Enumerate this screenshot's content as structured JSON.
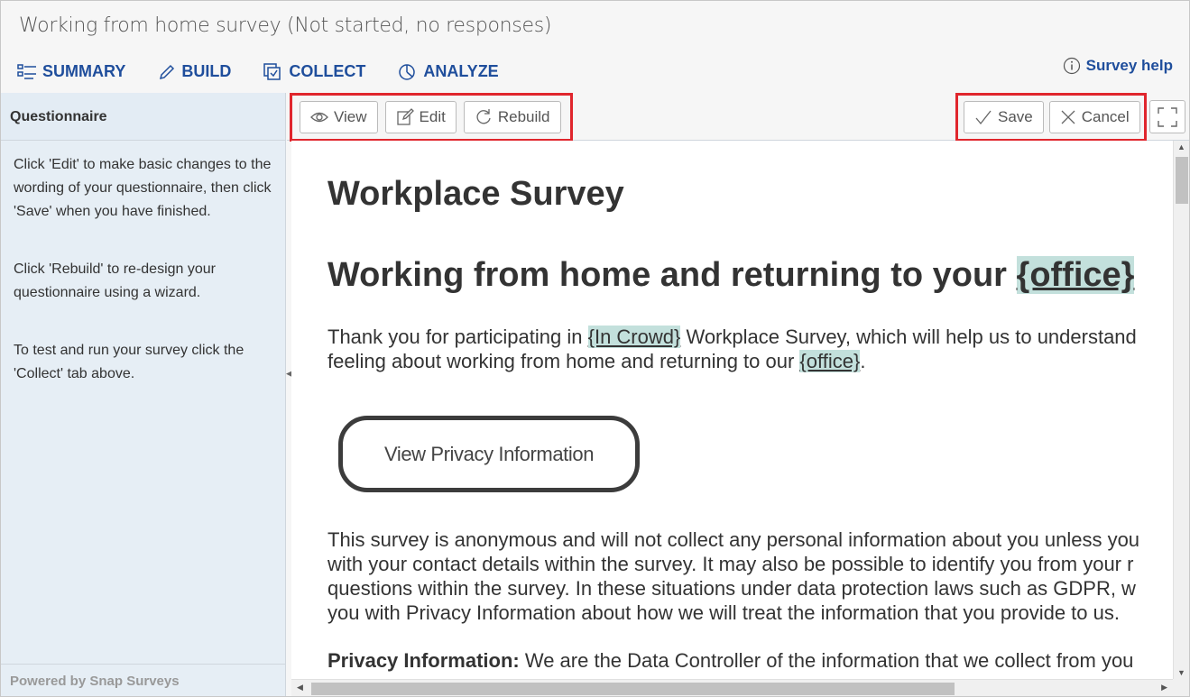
{
  "header": {
    "title": "Working from home survey (Not started, no responses)",
    "nav": [
      {
        "label": "SUMMARY",
        "icon": "summary-icon"
      },
      {
        "label": "BUILD",
        "icon": "pencil-icon"
      },
      {
        "label": "COLLECT",
        "icon": "collect-icon"
      },
      {
        "label": "ANALYZE",
        "icon": "analyze-icon"
      }
    ],
    "help_label": "Survey help"
  },
  "sidebar": {
    "heading": "Questionnaire",
    "paragraphs": [
      "Click 'Edit' to make basic changes to the wording of your questionnaire, then click 'Save' when you have finished.",
      "Click 'Rebuild' to re-design your questionnaire using a wizard.",
      "To test and run your survey click the 'Collect' tab above."
    ],
    "footer": "Powered by Snap Surveys"
  },
  "toolbar": {
    "view_label": "View",
    "edit_label": "Edit",
    "rebuild_label": "Rebuild",
    "save_label": "Save",
    "cancel_label": "Cancel",
    "highlight_color": "#e0262d"
  },
  "document": {
    "title": "Workplace Survey",
    "heading_pre": "Working from home and returning to your ",
    "heading_tag": "{office}",
    "intro_1_pre": "Thank you for participating in ",
    "intro_1_tag": "{In Crowd}",
    "intro_1_post": " Workplace Survey, which will help us to understand",
    "intro_2_pre": "feeling about working from home and returning to our ",
    "intro_2_tag": "{office}",
    "intro_2_post": ".",
    "privacy_button": "View Privacy Information",
    "anon_lines": [
      "This survey is anonymous and will not collect any personal information about you unless you",
      "with your contact details within the survey. It may also be possible to identify you from your r",
      "questions within the survey. In these situations under data protection laws such as GDPR, w",
      "you with Privacy Information about how we will treat the information that you provide to us."
    ],
    "privacy_label": "Privacy Information:",
    "privacy_text": " We are the Data Controller of the information that we collect from you",
    "tag_color": "#c3e0dc"
  }
}
